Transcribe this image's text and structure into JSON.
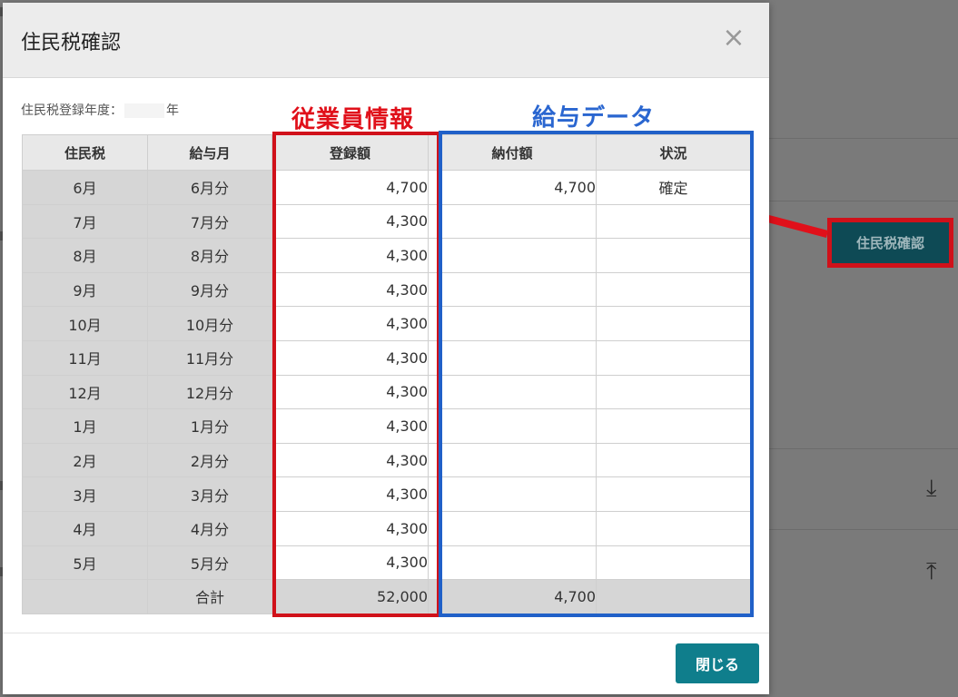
{
  "dialog": {
    "title": "住民税確認",
    "close_icon": "×",
    "year_label": "住民税登録年度：",
    "year_suffix": "年",
    "close_button": "閉じる"
  },
  "annotations": {
    "employee_info": "従業員情報",
    "payroll_data": "給与データ"
  },
  "table": {
    "headers": [
      "住民税",
      "給与月",
      "登録額",
      "納付額",
      "状況"
    ],
    "rows": [
      [
        "6月",
        "6月分",
        "4,700",
        "4,700",
        "確定"
      ],
      [
        "7月",
        "7月分",
        "4,300",
        "",
        ""
      ],
      [
        "8月",
        "8月分",
        "4,300",
        "",
        ""
      ],
      [
        "9月",
        "9月分",
        "4,300",
        "",
        ""
      ],
      [
        "10月",
        "10月分",
        "4,300",
        "",
        ""
      ],
      [
        "11月",
        "11月分",
        "4,300",
        "",
        ""
      ],
      [
        "12月",
        "12月分",
        "4,300",
        "",
        ""
      ],
      [
        "1月",
        "1月分",
        "4,300",
        "",
        ""
      ],
      [
        "2月",
        "2月分",
        "4,300",
        "",
        ""
      ],
      [
        "3月",
        "3月分",
        "4,300",
        "",
        ""
      ],
      [
        "4月",
        "4月分",
        "4,300",
        "",
        ""
      ],
      [
        "5月",
        "5月分",
        "4,300",
        "",
        ""
      ]
    ],
    "total": [
      "",
      "合計",
      "52,000",
      "4,700",
      ""
    ]
  },
  "side_button": "住民税確認",
  "background_icons": [
    "download-icon",
    "upload-icon"
  ],
  "colors": {
    "teal": "#0f7e8c",
    "red_annotation": "#d0111a",
    "blue_annotation": "#2060c8"
  }
}
